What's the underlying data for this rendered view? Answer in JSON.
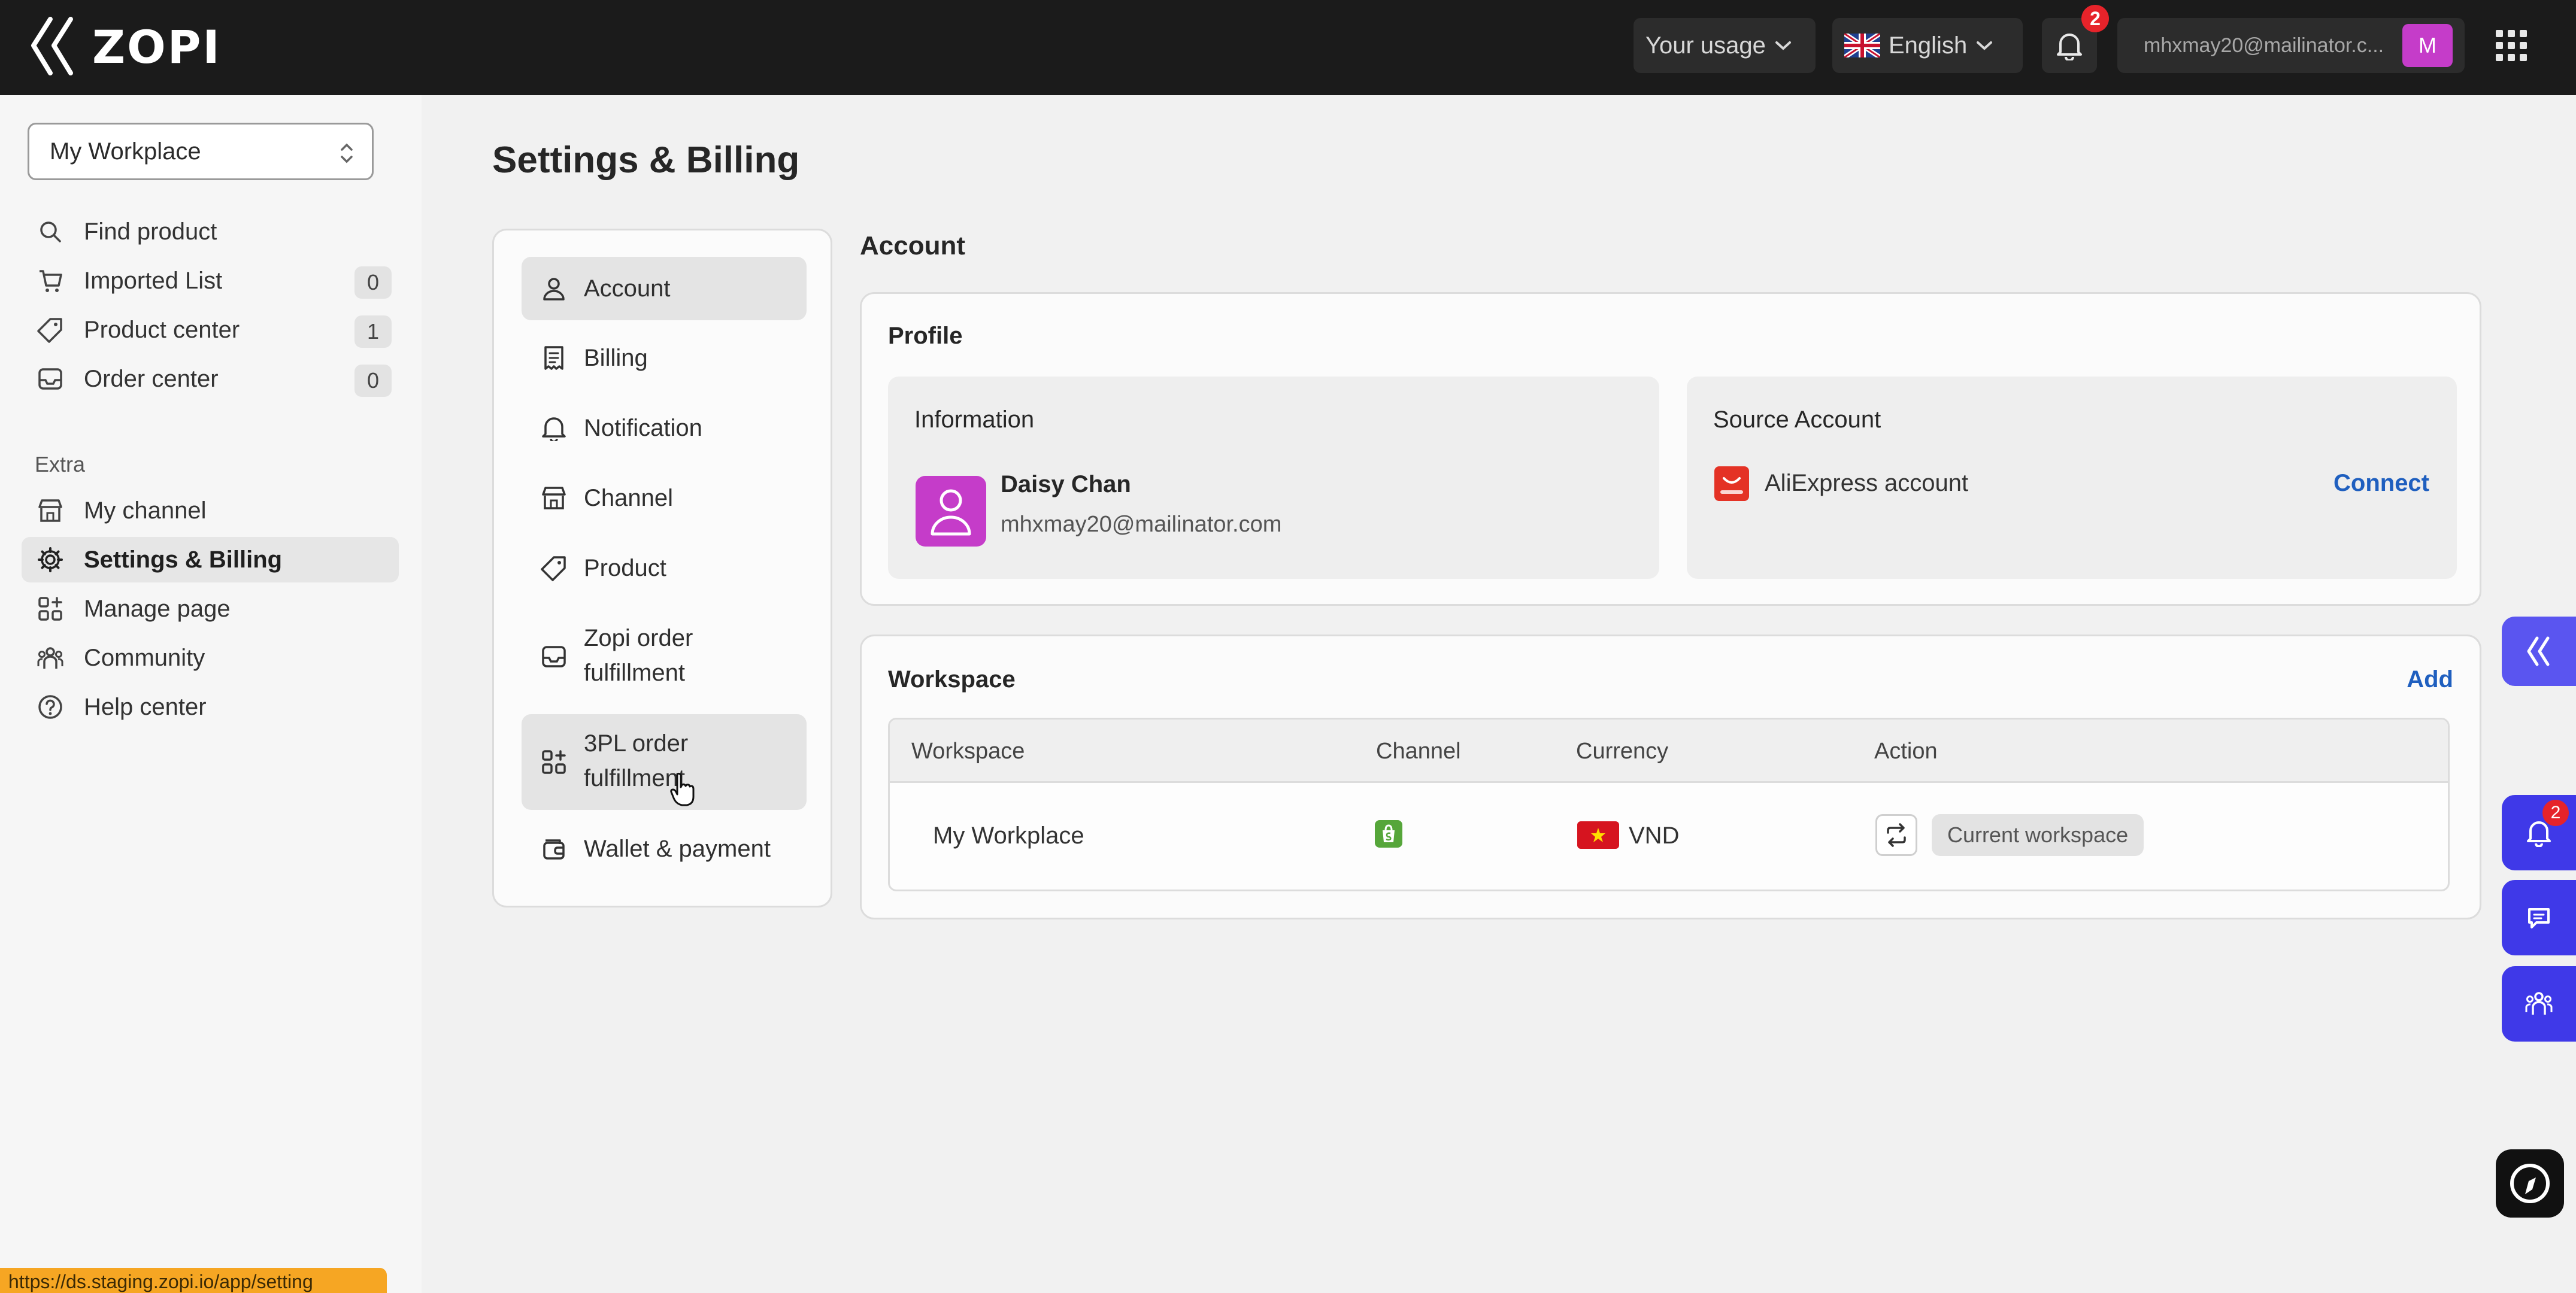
{
  "brand": {
    "name": "ZOPI"
  },
  "topbar": {
    "usage_label": "Your usage",
    "language_label": "English",
    "notification_count": "2",
    "user_email": "mhxmay20@mailinator.c...",
    "user_initial": "M"
  },
  "sidebar": {
    "workspace": "My Workplace",
    "main_items": [
      {
        "label": "Find product"
      },
      {
        "label": "Imported List",
        "count": "0"
      },
      {
        "label": "Product center",
        "count": "1"
      },
      {
        "label": "Order center",
        "count": "0"
      }
    ],
    "extra_label": "Extra",
    "extra_items": [
      {
        "label": "My channel"
      },
      {
        "label": "Settings & Billing"
      },
      {
        "label": "Manage page"
      },
      {
        "label": "Community"
      },
      {
        "label": "Help center"
      }
    ]
  },
  "page": {
    "title": "Settings & Billing"
  },
  "settings_menu": [
    {
      "label": "Account"
    },
    {
      "label": "Billing"
    },
    {
      "label": "Notification"
    },
    {
      "label": "Channel"
    },
    {
      "label": "Product"
    },
    {
      "label_line1": "Zopi order",
      "label_line2": "fulfillment"
    },
    {
      "label_line1": "3PL order",
      "label_line2": "fulfillment"
    },
    {
      "label": "Wallet & payment"
    }
  ],
  "account": {
    "section_title": "Account",
    "profile": {
      "title": "Profile",
      "information": {
        "title": "Information",
        "name": "Daisy Chan",
        "email": "mhxmay20@mailinator.com"
      },
      "source_account": {
        "title": "Source Account",
        "provider": "AliExpress account",
        "action": "Connect"
      }
    },
    "workspace": {
      "title": "Workspace",
      "add_label": "Add",
      "columns": [
        "Workspace",
        "Channel",
        "Currency",
        "Action"
      ],
      "rows": [
        {
          "name": "My Workplace",
          "currency": "VND",
          "status": "Current workspace"
        }
      ]
    }
  },
  "floating": {
    "notification_count": "2"
  },
  "status_url": "https://ds.staging.zopi.io/app/setting"
}
